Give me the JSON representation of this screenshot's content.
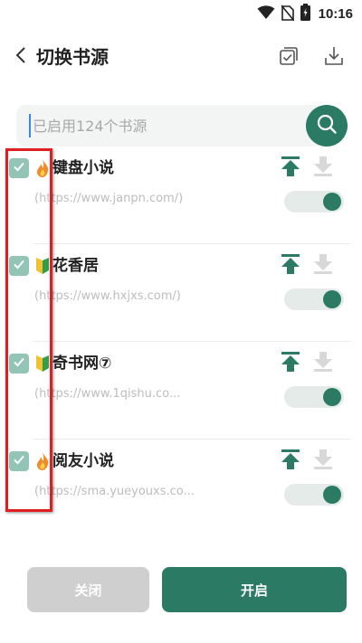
{
  "status_bar": {
    "time": "10:16"
  },
  "header": {
    "title": "切换书源"
  },
  "search": {
    "placeholder": "已启用124个书源"
  },
  "sources": [
    {
      "name": "键盘小说",
      "url": "(https://www.janpn.com/)",
      "badge": "fire",
      "checked": true,
      "enabled": true
    },
    {
      "name": "花香居",
      "url": "(https://www.hxjxs.com/)",
      "badge": "beginner",
      "checked": true,
      "enabled": true
    },
    {
      "name": "奇书网⑦",
      "url": "(https://www.1qishu.co...",
      "badge": "beginner",
      "checked": true,
      "enabled": true
    },
    {
      "name": "阅友小说",
      "url": "(https://sma.yueyouxs.co...",
      "badge": "fire",
      "checked": true,
      "enabled": true
    }
  ],
  "buttons": {
    "close": "关闭",
    "open": "开启"
  },
  "colors": {
    "accent": "#2b7a63",
    "checkbox": "#93c5b6",
    "highlight": "#e02020",
    "disabled_button": "#cfcfcf"
  },
  "icons": {
    "status": [
      "wifi-icon",
      "no-sim-icon",
      "battery-icon"
    ],
    "header": [
      "back-icon",
      "select-all-icon",
      "download-icon"
    ],
    "search": "search-icon",
    "row": [
      "check-icon",
      "source-badge-icon",
      "move-to-top-icon",
      "download-icon",
      "enable-toggle"
    ]
  }
}
